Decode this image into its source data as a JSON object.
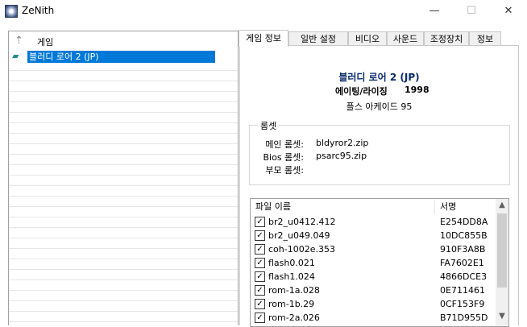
{
  "window": {
    "title": "ZeNith",
    "min_glyph": "—",
    "max_glyph": "☐",
    "close_glyph": "✕"
  },
  "tree": {
    "header": "게임",
    "items": [
      {
        "label": "블러디 로어 2 (JP)",
        "selected": true
      }
    ]
  },
  "tabs": [
    {
      "label": "게임 정보",
      "active": true
    },
    {
      "label": "일반 설정"
    },
    {
      "label": "비디오"
    },
    {
      "label": "사운드"
    },
    {
      "label": "조정장치"
    },
    {
      "label": "정보"
    }
  ],
  "game_info": {
    "title": "블러디 로어 2 (JP)",
    "company": "에이팅/라이징",
    "year": "1998",
    "system": "플스 아케이드 95"
  },
  "romset": {
    "legend": "롬셋",
    "main_label": "메인 롬셋:",
    "main_value": "bldyror2.zip",
    "bios_label": "Bios 롬셋:",
    "bios_value": "psarc95.zip",
    "parent_label": "부모 롬셋:",
    "parent_value": ""
  },
  "file_list": {
    "col_name": "파일 이름",
    "col_sig": "서명",
    "rows": [
      {
        "name": "br2_u0412.412",
        "sig": "E254DD8A",
        "checked": true
      },
      {
        "name": "br2_u049.049",
        "sig": "10DC855B",
        "checked": true
      },
      {
        "name": "coh-1002e.353",
        "sig": "910F3A8B",
        "checked": true
      },
      {
        "name": "flash0.021",
        "sig": "FA7602E1",
        "checked": true
      },
      {
        "name": "flash1.024",
        "sig": "4866DCE3",
        "checked": true
      },
      {
        "name": "rom-1a.028",
        "sig": "0E711461",
        "checked": true
      },
      {
        "name": "rom-1b.29",
        "sig": "0CF153F9",
        "checked": true
      },
      {
        "name": "rom-2a.026",
        "sig": "B71D955D",
        "checked": true
      }
    ]
  },
  "colors": {
    "selection": "#0078d7",
    "title_text": "#0a2a6e"
  }
}
